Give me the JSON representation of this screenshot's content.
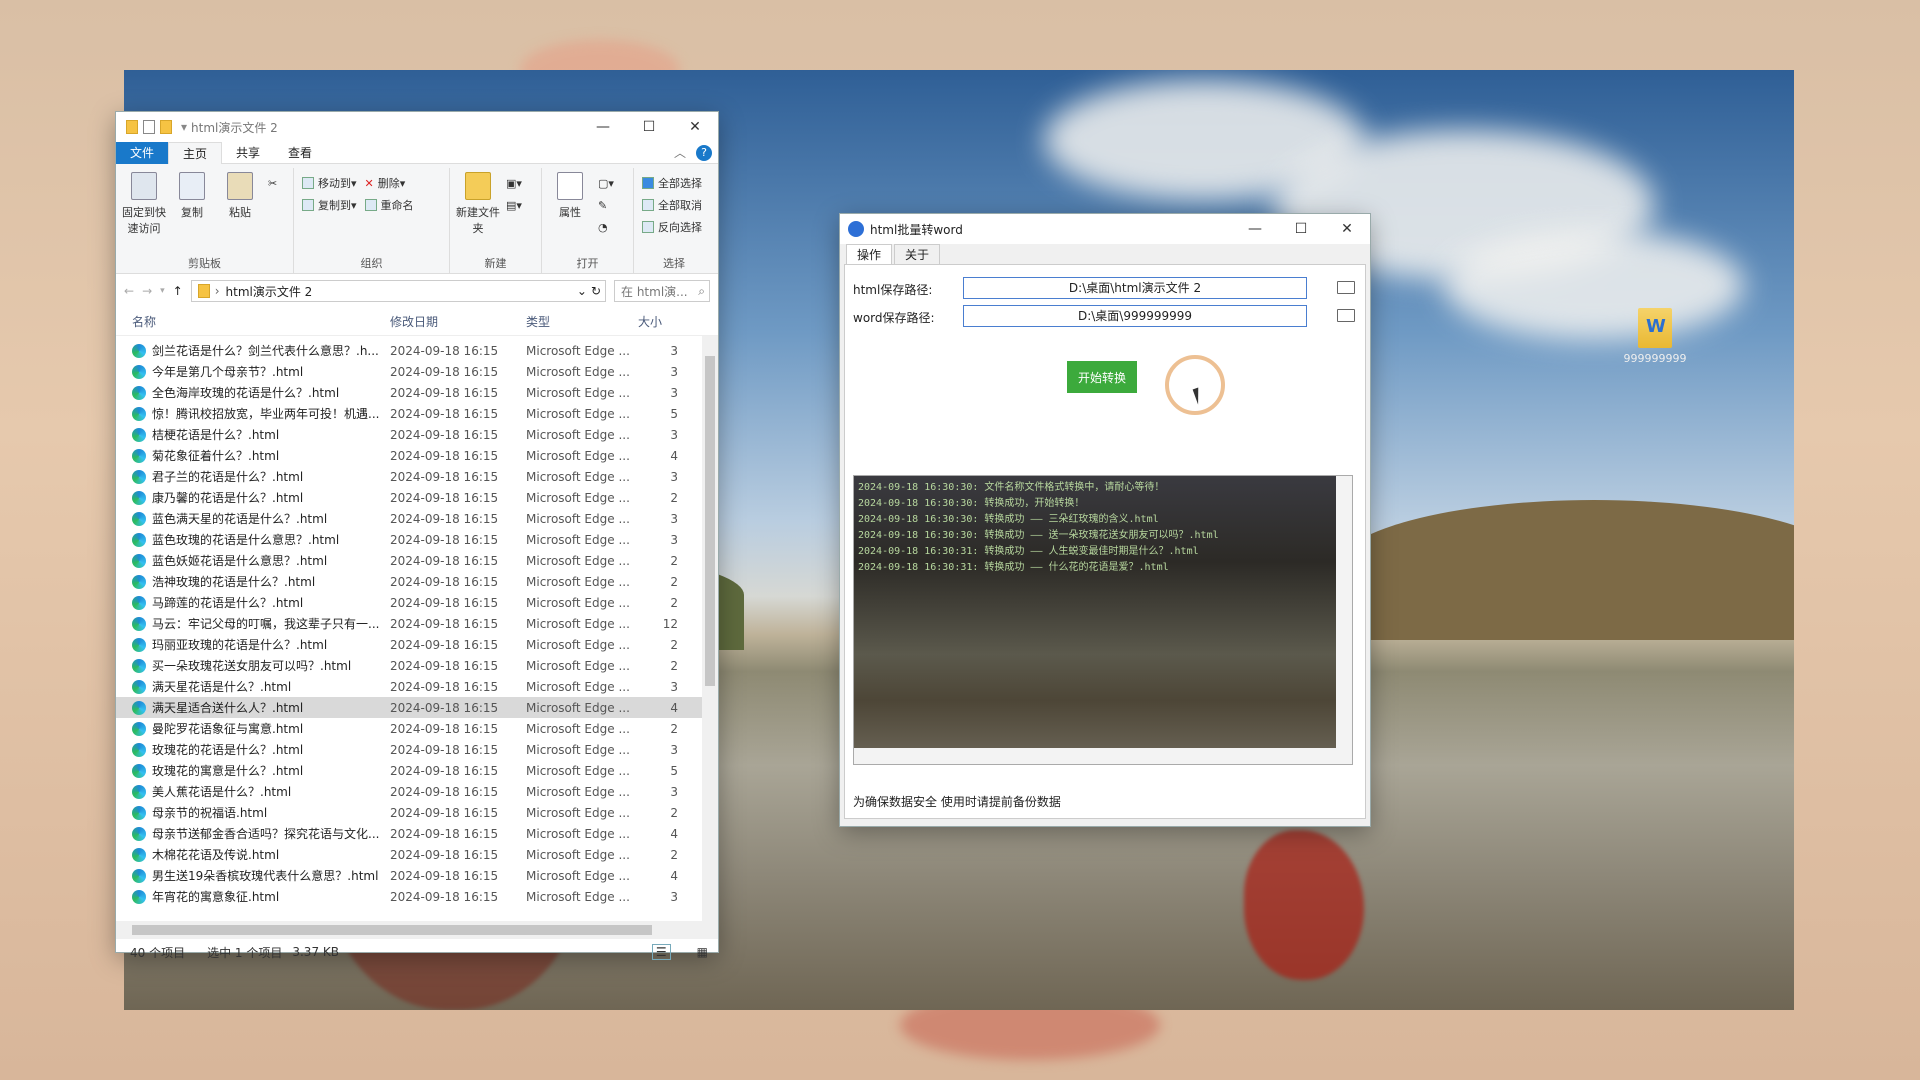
{
  "explorer": {
    "title": "html演示文件 2",
    "tabs": {
      "file": "文件",
      "home": "主页",
      "share": "共享",
      "view": "查看"
    },
    "ribbon": {
      "pin": "固定到快速访问",
      "copy": "复制",
      "paste": "粘贴",
      "move_to": "移动到",
      "copy_to": "复制到",
      "delete": "删除",
      "rename": "重命名",
      "new_folder": "新建文件夹",
      "properties": "属性",
      "select_all": "全部选择",
      "select_none": "全部取消",
      "invert": "反向选择",
      "groups": {
        "clipboard": "剪贴板",
        "organize": "组织",
        "new": "新建",
        "open": "打开",
        "select": "选择"
      }
    },
    "address": "html演示文件 2",
    "search_placeholder": "在 html演...",
    "columns": {
      "name": "名称",
      "date": "修改日期",
      "type": "类型",
      "size": "大小"
    },
    "files": [
      {
        "name": "剑兰花语是什么？剑兰代表什么意思？.h...",
        "date": "2024-09-18 16:15",
        "type": "Microsoft Edge ...",
        "size": "3"
      },
      {
        "name": "今年是第几个母亲节？.html",
        "date": "2024-09-18 16:15",
        "type": "Microsoft Edge ...",
        "size": "3"
      },
      {
        "name": "全色海岸玫瑰的花语是什么？.html",
        "date": "2024-09-18 16:15",
        "type": "Microsoft Edge ...",
        "size": "3"
      },
      {
        "name": "惊！腾讯校招放宽，毕业两年可投！机遇...",
        "date": "2024-09-18 16:15",
        "type": "Microsoft Edge ...",
        "size": "5"
      },
      {
        "name": "桔梗花语是什么？.html",
        "date": "2024-09-18 16:15",
        "type": "Microsoft Edge ...",
        "size": "3"
      },
      {
        "name": "菊花象征着什么？.html",
        "date": "2024-09-18 16:15",
        "type": "Microsoft Edge ...",
        "size": "4"
      },
      {
        "name": "君子兰的花语是什么？.html",
        "date": "2024-09-18 16:15",
        "type": "Microsoft Edge ...",
        "size": "3"
      },
      {
        "name": "康乃馨的花语是什么？.html",
        "date": "2024-09-18 16:15",
        "type": "Microsoft Edge ...",
        "size": "2"
      },
      {
        "name": "蓝色满天星的花语是什么？.html",
        "date": "2024-09-18 16:15",
        "type": "Microsoft Edge ...",
        "size": "3"
      },
      {
        "name": "蓝色玫瑰的花语是什么意思？.html",
        "date": "2024-09-18 16:15",
        "type": "Microsoft Edge ...",
        "size": "3"
      },
      {
        "name": "蓝色妖姬花语是什么意思？.html",
        "date": "2024-09-18 16:15",
        "type": "Microsoft Edge ...",
        "size": "2"
      },
      {
        "name": "浩神玫瑰的花语是什么？.html",
        "date": "2024-09-18 16:15",
        "type": "Microsoft Edge ...",
        "size": "2"
      },
      {
        "name": "马蹄莲的花语是什么？.html",
        "date": "2024-09-18 16:15",
        "type": "Microsoft Edge ...",
        "size": "2"
      },
      {
        "name": "马云：牢记父母的叮嘱，我这辈子只有一...",
        "date": "2024-09-18 16:15",
        "type": "Microsoft Edge ...",
        "size": "12"
      },
      {
        "name": "玛丽亚玫瑰的花语是什么？.html",
        "date": "2024-09-18 16:15",
        "type": "Microsoft Edge ...",
        "size": "2"
      },
      {
        "name": "买一朵玫瑰花送女朋友可以吗？.html",
        "date": "2024-09-18 16:15",
        "type": "Microsoft Edge ...",
        "size": "2"
      },
      {
        "name": "满天星花语是什么？.html",
        "date": "2024-09-18 16:15",
        "type": "Microsoft Edge ...",
        "size": "3"
      },
      {
        "name": "满天星适合送什么人？.html",
        "date": "2024-09-18 16:15",
        "type": "Microsoft Edge ...",
        "size": "4"
      },
      {
        "name": "曼陀罗花语象征与寓意.html",
        "date": "2024-09-18 16:15",
        "type": "Microsoft Edge ...",
        "size": "2"
      },
      {
        "name": "玫瑰花的花语是什么？.html",
        "date": "2024-09-18 16:15",
        "type": "Microsoft Edge ...",
        "size": "3"
      },
      {
        "name": "玫瑰花的寓意是什么？.html",
        "date": "2024-09-18 16:15",
        "type": "Microsoft Edge ...",
        "size": "5"
      },
      {
        "name": "美人蕉花语是什么？.html",
        "date": "2024-09-18 16:15",
        "type": "Microsoft Edge ...",
        "size": "3"
      },
      {
        "name": "母亲节的祝福语.html",
        "date": "2024-09-18 16:15",
        "type": "Microsoft Edge ...",
        "size": "2"
      },
      {
        "name": "母亲节送郁金香合适吗？探究花语与文化...",
        "date": "2024-09-18 16:15",
        "type": "Microsoft Edge ...",
        "size": "4"
      },
      {
        "name": "木棉花花语及传说.html",
        "date": "2024-09-18 16:15",
        "type": "Microsoft Edge ...",
        "size": "2"
      },
      {
        "name": "男生送19朵香槟玫瑰代表什么意思？.html",
        "date": "2024-09-18 16:15",
        "type": "Microsoft Edge ...",
        "size": "4"
      },
      {
        "name": "年宵花的寓意象征.html",
        "date": "2024-09-18 16:15",
        "type": "Microsoft Edge ...",
        "size": "3"
      }
    ],
    "selected_index": 17,
    "status": {
      "count": "40 个项目",
      "selected": "选中 1 个项目",
      "size": "3.37 KB"
    }
  },
  "converter": {
    "title": "html批量转word",
    "tabs": {
      "ops": "操作",
      "about": "关于"
    },
    "html_label": "html保存路径:",
    "html_path": "D:\\桌面\\html演示文件 2",
    "word_label": "word保存路径:",
    "word_path": "D:\\桌面\\999999999",
    "start_label": "开始转换",
    "log": [
      "2024-09-18 16:30:30: 文件名称文件格式转换中，请耐心等待！",
      "2024-09-18 16:30:30: 转换成功，开始转换！",
      "2024-09-18 16:30:30: 转换成功 —— 三朵红玫瑰的含义.html",
      "2024-09-18 16:30:30: 转换成功 —— 送一朵玫瑰花送女朋友可以吗？.html",
      "2024-09-18 16:30:31: 转换成功 —— 人生蜕变最佳时期是什么？.html",
      "2024-09-18 16:30:31: 转换成功 —— 什么花的花语是爱？.html"
    ],
    "note": "为确保数据安全 使用时请提前备份数据"
  },
  "desktop": {
    "icon_label": "999999999"
  }
}
